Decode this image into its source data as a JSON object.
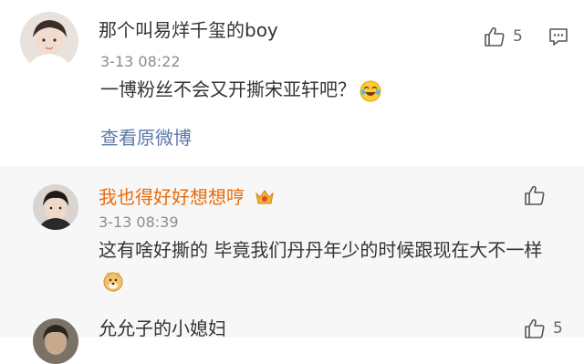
{
  "main_comment": {
    "username": "那个叫易烊千玺的boy",
    "timestamp": "3-13 08:22",
    "text": "一博粉丝不会又开撕宋亚轩吧？",
    "emoji": "laughing-crying-emoji",
    "like_count": "5",
    "view_original": "查看原微博",
    "username_color": "#333333"
  },
  "replies": [
    {
      "username": "我也得好好想想哼",
      "timestamp": "3-13 08:39",
      "text": "这有啥好撕的  毕竟我们丹丹年少的时候跟现在大不一样",
      "emoji": "doge-emoji",
      "like_count": "",
      "badge": "crown-badge",
      "username_color": "#e86a0b"
    },
    {
      "username": "允允子的小媳妇",
      "like_count": "5",
      "username_color": "#333333"
    }
  ],
  "colors": {
    "link": "#5a7aa8",
    "reply_background": "#f7f7f7",
    "timestamp": "#8c8c8c"
  }
}
